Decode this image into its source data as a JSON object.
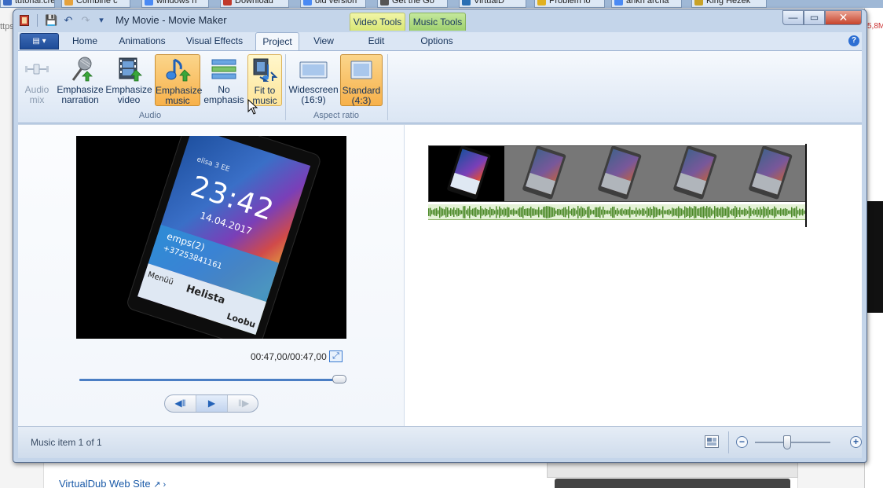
{
  "browser": {
    "tabs": [
      {
        "label": "tutorial:cre",
        "color": "#3b6bc4"
      },
      {
        "label": "Combine c",
        "color": "#e6a23c"
      },
      {
        "label": "windows n",
        "color": "#4a8af4"
      },
      {
        "label": "Download",
        "color": "#c0392b"
      },
      {
        "label": "old version",
        "color": "#4a8af4"
      },
      {
        "label": "Get the Go",
        "color": "#555555"
      },
      {
        "label": "VirtualD",
        "color": "#2a6fb3"
      },
      {
        "label": "Problem lo",
        "color": "#e0b020"
      },
      {
        "label": "ankh archa",
        "color": "#4a8af4"
      },
      {
        "label": "King Hezek",
        "color": "#c9a227"
      }
    ],
    "url_fragment": "ttps",
    "speed_fragment": "5,8M",
    "page_link": "VirtualDub Web Site",
    "page_link_suffix": "↗ ›"
  },
  "window": {
    "title": "My Movie - Movie Maker",
    "contextual_tabs": {
      "video": "Video Tools",
      "music": "Music Tools"
    },
    "controls": {
      "minimize": "—",
      "maximize": "▭",
      "close": "✕"
    }
  },
  "quick_access": {
    "save_icon": "💾",
    "undo_icon": "↶",
    "redo_icon": "↷",
    "dropdown_icon": "▾"
  },
  "ribbon": {
    "app_menu_label": "▤ ▾",
    "tabs": [
      "Home",
      "Animations",
      "Visual Effects",
      "Project",
      "View",
      "Edit",
      "Options"
    ],
    "active_tab": "Project",
    "help_label": "?",
    "groups": {
      "audio": {
        "label": "Audio",
        "buttons": [
          {
            "line1": "Audio",
            "line2": "mix",
            "state": "disabled"
          },
          {
            "line1": "Emphasize",
            "line2": "narration",
            "state": "normal"
          },
          {
            "line1": "Emphasize",
            "line2": "video",
            "state": "normal"
          },
          {
            "line1": "Emphasize",
            "line2": "music",
            "state": "selected"
          },
          {
            "line1": "No",
            "line2": "emphasis",
            "state": "normal"
          },
          {
            "line1": "Fit to",
            "line2": "music",
            "state": "hover"
          }
        ]
      },
      "aspect_ratio": {
        "label": "Aspect ratio",
        "buttons": [
          {
            "line1": "Widescreen",
            "line2": "(16:9)",
            "state": "normal"
          },
          {
            "line1": "Standard",
            "line2": "(4:3)",
            "state": "selected"
          }
        ]
      }
    }
  },
  "preview": {
    "phone_screen": {
      "time": "23:42",
      "date": "14.04.2017",
      "operator": "elisa 3 EE",
      "notification": "emps(2)",
      "number": "+37253841161",
      "left_soft": "Menüü",
      "center_soft": "Helista",
      "right_soft": "Loobu"
    },
    "timecode": "00:47,00/00:47,00",
    "fullscreen_icon": "⤢",
    "progress": 1.0,
    "playback": {
      "prev_icon": "◀‖",
      "play_icon": "▶",
      "next_icon": "‖▶"
    }
  },
  "storyboard": {
    "thumbnail_count": 5,
    "selected_index": 0
  },
  "statusbar": {
    "text": "Music item 1 of 1",
    "zoom_out_icon": "−",
    "zoom_in_icon": "+",
    "zoom_level": 0.4
  },
  "colors": {
    "accent": "#4a7ec4",
    "selected": "#f7b14b",
    "waveform": "#4d8a2a"
  }
}
